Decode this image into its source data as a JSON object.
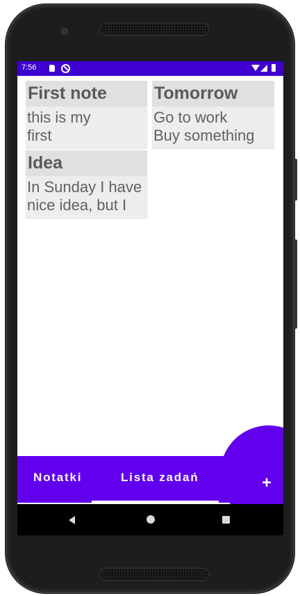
{
  "status_bar": {
    "time": "7:56",
    "icons": [
      "sd-card-icon",
      "sync-icon",
      "wifi-icon",
      "signal-icon",
      "battery-icon"
    ]
  },
  "notes": [
    {
      "title": "First note",
      "lines": [
        "this is my",
        "first"
      ]
    },
    {
      "title": "Tomorrow",
      "lines": [
        "Go to work",
        "Buy something"
      ]
    },
    {
      "title": "Idea",
      "lines": [
        "In Sunday I have",
        "nice idea, but I"
      ]
    }
  ],
  "tabs": [
    {
      "label": "Notatki",
      "selected": false
    },
    {
      "label": "Lista zadań",
      "selected": true
    }
  ],
  "fab": {
    "label": "+"
  },
  "colors": {
    "primary": "#6200ee",
    "status_bar": "#3d00d1",
    "card": "#ededed",
    "card_title": "#e0e0e0"
  },
  "nav_bar": {
    "icons": [
      "back-icon",
      "home-icon",
      "recents-icon"
    ]
  }
}
